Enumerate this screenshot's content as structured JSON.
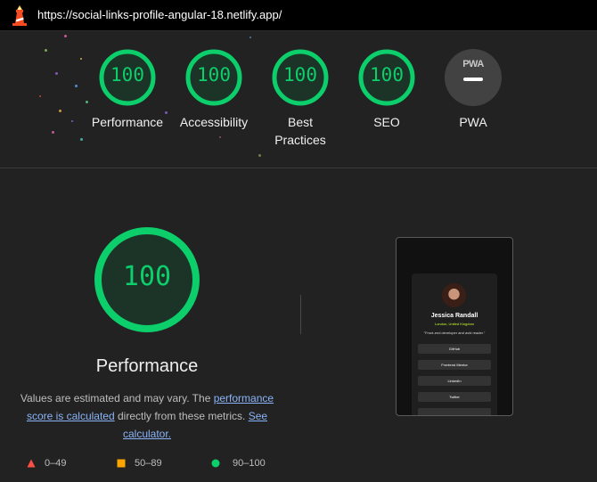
{
  "topbar": {
    "url": "https://social-links-profile-angular-18.netlify.app/"
  },
  "summary": {
    "gauges": [
      {
        "label": "Performance",
        "score": "100"
      },
      {
        "label": "Accessibility",
        "score": "100"
      },
      {
        "label": "Best Practices",
        "score": "100"
      },
      {
        "label": "SEO",
        "score": "100"
      }
    ],
    "pwa": {
      "badge": "PWA",
      "label": "PWA"
    }
  },
  "performance": {
    "score": "100",
    "title": "Performance",
    "desc_part1": "Values are estimated and may vary. The ",
    "desc_link1": "performance score is calculated",
    "desc_part2": " directly from these metrics. ",
    "desc_link2": "See calculator."
  },
  "legend": [
    {
      "range": "0–49",
      "color": "#ff4e42"
    },
    {
      "range": "50–89",
      "color": "#ffa400"
    },
    {
      "range": "90–100",
      "color": "#0cce6b"
    }
  ],
  "screenshot": {
    "name": "Jessica Randall",
    "location": "London, United Kingdom",
    "quote": "\"Front-end developer and avid reader.\"",
    "links": [
      "GitHub",
      "Frontend Mentor",
      "LinkedIn",
      "Twitter"
    ]
  },
  "colors": {
    "pass": "#0cce6b",
    "background": "#222222"
  }
}
